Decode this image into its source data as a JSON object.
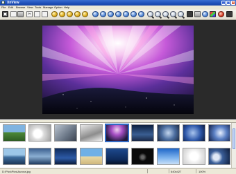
{
  "window": {
    "title": "XnView"
  },
  "menu": {
    "items": [
      "File",
      "Edit",
      "Browse",
      "View",
      "Tools",
      "Manage",
      "Option",
      "Help"
    ]
  },
  "toolbar": {
    "buttons": [
      "open-icon",
      "browse-icon",
      "save-icon",
      "properties-icon",
      "cut-icon",
      "copy-icon",
      "paste-icon",
      "first-image-icon",
      "previous-image-icon",
      "next-image-icon",
      "last-image-icon",
      "slideshow-icon",
      "refresh-icon",
      "rotate-left-icon",
      "rotate-right-icon",
      "flip-icon",
      "mirror-icon",
      "crop-icon",
      "resize-icon",
      "zoom-in-icon",
      "zoom-out-icon",
      "zoom-fit-icon",
      "zoom-actual-icon",
      "zoom-full-icon",
      "fullscreen-icon",
      "adjust-icon",
      "color-icon",
      "filter-icon",
      "effects-icon",
      "exit-icon",
      "help-icon"
    ]
  },
  "thumbnails": {
    "rows": [
      [
        "landscape-green",
        "white-flower-swirl",
        "gray-abstract",
        "sketch-white",
        "dark-aurora",
        "blue-window",
        "gray-gradient",
        "blue-flower",
        "blue-leaf-circle",
        "blue-sparkle"
      ],
      [
        "water-mountain",
        "sky-evening",
        "dark-blue-lake",
        "beach-sunset",
        "dark-blue-island",
        "black-bird",
        "blue-gradient-sky",
        "white-sphere",
        "gray-blue-sky",
        "moon-blue"
      ]
    ],
    "selected_index": 4
  },
  "status": {
    "path": "D:\\Pics\\Pics\\Aurora.jpg",
    "dimensions": "640x427",
    "zoom": "100%"
  },
  "colors": {
    "accent": "#316ac5",
    "viewer_bg": "#2a2a2a",
    "title_bar": "#1e4fb8"
  }
}
